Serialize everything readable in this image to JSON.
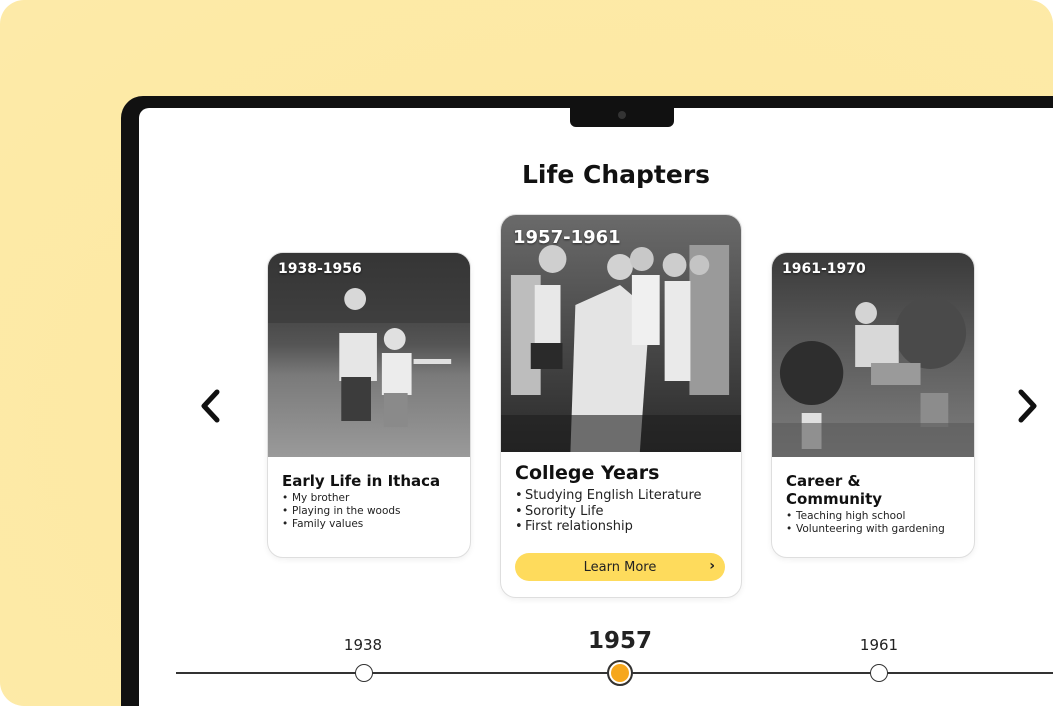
{
  "page": {
    "title": "Life Chapters"
  },
  "cards": [
    {
      "years": "1938-1956",
      "title": "Early Life in Ithaca",
      "items": [
        "My brother",
        "Playing in the woods",
        "Family values"
      ]
    },
    {
      "years": "1957-1961",
      "title": "College Years",
      "items": [
        "Studying English Literature",
        "Sorority Life",
        "First relationship"
      ],
      "button": "Learn More"
    },
    {
      "years": "1961-1970",
      "title": "Career & Community",
      "items": [
        "Teaching high school",
        "Volunteering with gardening"
      ]
    }
  ],
  "nav": {
    "prev_icon": "chevron-left-icon",
    "next_icon": "chevron-right-icon",
    "button_icon": "chevron-right-icon"
  },
  "timeline": {
    "years": [
      "1938",
      "1957",
      "1961"
    ],
    "active": "1957"
  },
  "colors": {
    "accent": "#fedb5c",
    "active_dot": "#f6a71d",
    "background": "#fde9a4"
  }
}
